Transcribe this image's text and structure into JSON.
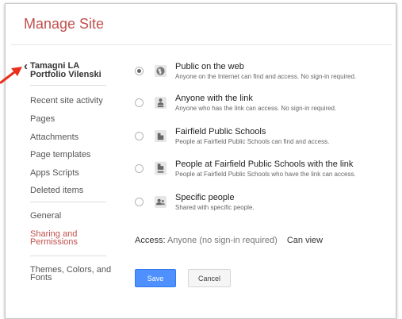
{
  "header": {
    "title": "Manage Site"
  },
  "back_link": {
    "line1": "Tamagni LA",
    "line2": "Portfolio Vilenski",
    "chevron": "‹"
  },
  "nav": {
    "items": [
      {
        "label": "Recent site activity"
      },
      {
        "label": "Pages"
      },
      {
        "label": "Attachments"
      },
      {
        "label": "Page templates"
      },
      {
        "label": "Apps Scripts"
      },
      {
        "label": "Deleted items"
      }
    ],
    "general": "General",
    "sharing_line1": "Sharing and",
    "sharing_line2": "Permissions",
    "themes_line1": "Themes, Colors, and",
    "themes_line2": "Fonts"
  },
  "options": [
    {
      "title": "Public on the web",
      "desc": "Anyone on the Internet can find and access. No sign-in required.",
      "icon": "globe-icon",
      "selected": true
    },
    {
      "title": "Anyone with the link",
      "desc": "Anyone who has the link can access. No sign-in required.",
      "icon": "person-link-icon",
      "selected": false
    },
    {
      "title": "Fairfield Public Schools",
      "desc": "People at Fairfield Public Schools can find and access.",
      "icon": "building-icon",
      "selected": false
    },
    {
      "title": "People at Fairfield Public Schools with the link",
      "desc": "People at Fairfield Public Schools who have the link can access.",
      "icon": "building-link-icon",
      "selected": false
    },
    {
      "title": "Specific people",
      "desc": "Shared with specific people.",
      "icon": "people-icon",
      "selected": false
    }
  ],
  "access": {
    "label": "Access:",
    "value": "Anyone (no sign-in required)",
    "permission": "Can view"
  },
  "buttons": {
    "save": "Save",
    "cancel": "Cancel"
  },
  "colors": {
    "accent": "#c0504d",
    "primary_button": "#4d90fe",
    "annotation_arrow": "#e8301c"
  }
}
